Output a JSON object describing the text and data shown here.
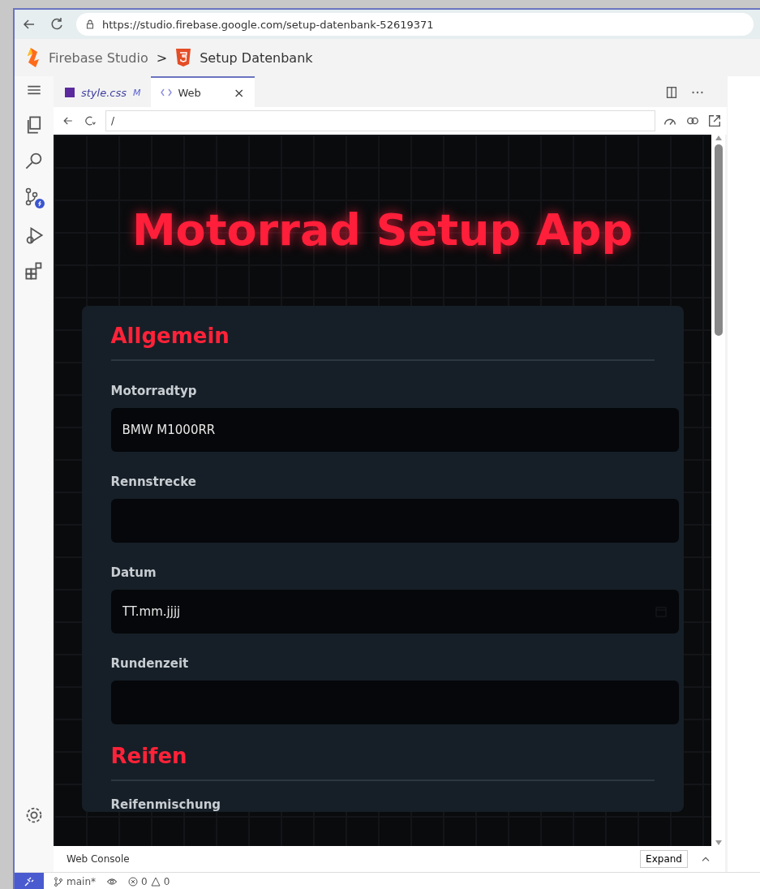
{
  "browser": {
    "url": "https://studio.firebase.google.com/setup-datenbank-52619371"
  },
  "header": {
    "app": "Firebase Studio",
    "separator": ">",
    "project": "Setup Datenbank"
  },
  "editor_tabs": [
    {
      "label": "style.css",
      "badge": "M",
      "selected": false,
      "closable": false
    },
    {
      "label": "Web",
      "selected": true,
      "closable": true,
      "close": "×"
    }
  ],
  "preview": {
    "path": "/",
    "title": "Motorrad Setup App",
    "sections": [
      {
        "heading": "Allgemein",
        "fields": [
          {
            "label": "Motorradtyp",
            "kind": "text",
            "value": "BMW M1000RR"
          },
          {
            "label": "Rennstrecke",
            "kind": "text"
          },
          {
            "label": "Datum",
            "kind": "date",
            "placeholder": "TT.mm.jjjj"
          },
          {
            "label": "Rundenzeit",
            "kind": "text"
          }
        ]
      },
      {
        "heading": "Reifen",
        "fields": [
          {
            "label": "Reifenmischung",
            "kind": "label_only"
          }
        ]
      }
    ]
  },
  "panel": {
    "title": "Web Console",
    "button": "Expand"
  },
  "status_bar": {
    "branch": "main*",
    "errors": "0",
    "warnings": "0"
  }
}
